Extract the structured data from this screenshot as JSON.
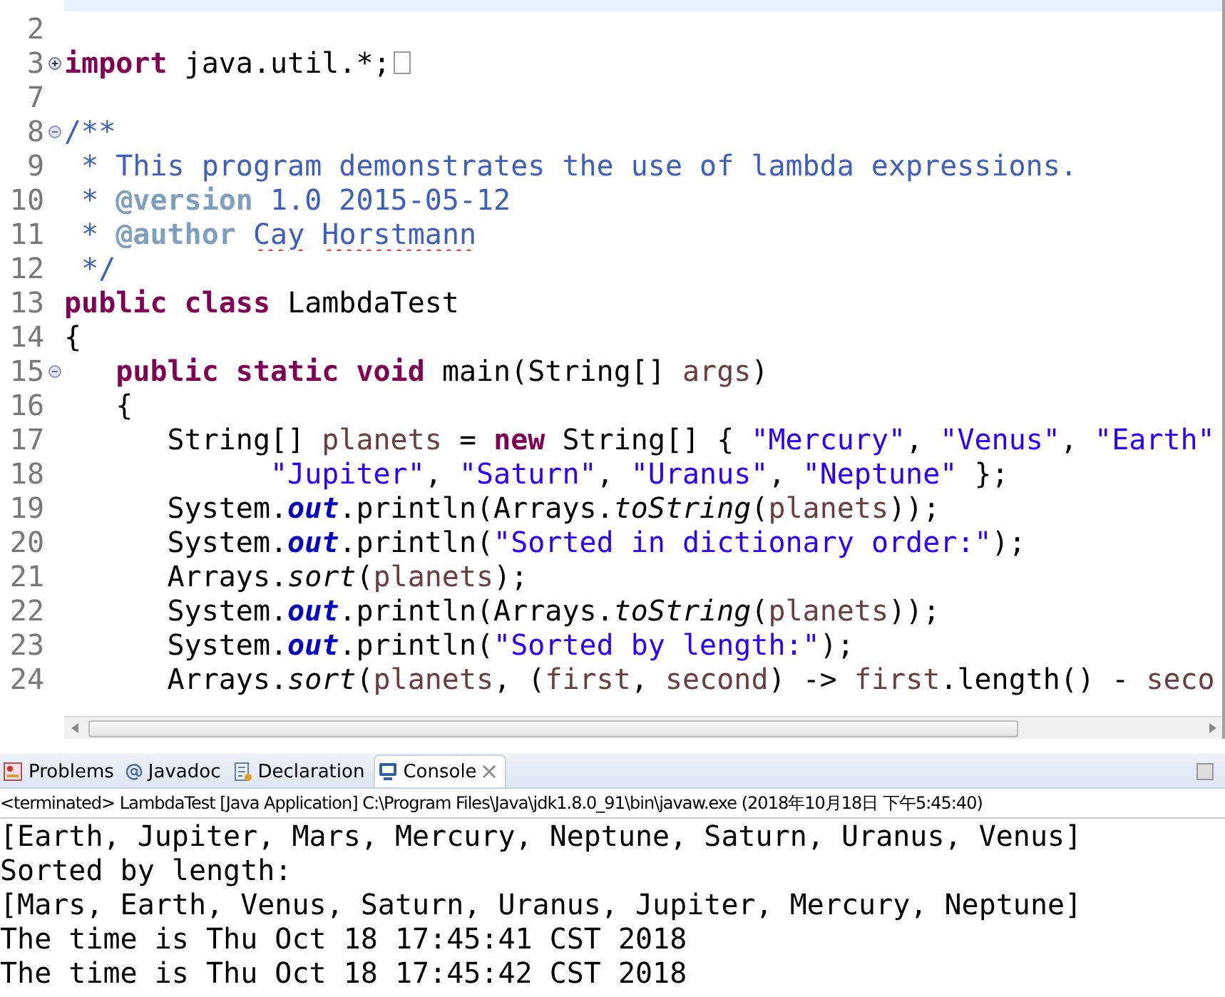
{
  "editor": {
    "lines": [
      {
        "current": true,
        "kind": "plain"
      },
      {
        "number": "2",
        "current": false,
        "kind": "plain"
      },
      {
        "number": "3",
        "current": false,
        "kind": "folded",
        "tokens": [
          {
            "text": "import",
            "kind": "keyword"
          },
          {
            "text": " java.util.*;",
            "kind": "plain"
          }
        ]
      },
      {
        "number": "7",
        "current": false,
        "kind": "plain"
      },
      {
        "number": "8",
        "current": false,
        "kind": "foldable",
        "tokens": [
          {
            "text": "/**",
            "kind": "javadoc"
          }
        ]
      },
      {
        "number": "9",
        "current": false,
        "kind": "plain",
        "tokens": [
          {
            "text": " * This program demonstrates the use of lambda expressions.",
            "kind": "javadoc"
          }
        ]
      },
      {
        "number": "10",
        "current": false,
        "kind": "plain",
        "tokens": [
          {
            "text": " * ",
            "kind": "javadoc"
          },
          {
            "text": "@version",
            "kind": "javadoc-tag"
          },
          {
            "text": " 1.0 2015-05-12",
            "kind": "javadoc"
          }
        ]
      },
      {
        "number": "11",
        "current": false,
        "kind": "plain",
        "tokens": [
          {
            "text": " * ",
            "kind": "javadoc"
          },
          {
            "text": "@author",
            "kind": "javadoc-tag"
          },
          {
            "text": " Cay",
            "kind": "misspelled"
          },
          {
            "text": " Horstmann",
            "kind": "misspelled"
          }
        ]
      },
      {
        "number": "12",
        "current": false,
        "kind": "plain",
        "tokens": [
          {
            "text": " */",
            "kind": "javadoc"
          }
        ]
      },
      {
        "number": "13",
        "current": false,
        "kind": "plain",
        "tokens": [
          {
            "text": "public",
            "kind": "keyword"
          },
          {
            "text": " class",
            "kind": "keyword"
          },
          {
            "text": " LambdaTest",
            "kind": "plain"
          }
        ]
      },
      {
        "number": "14",
        "current": false,
        "kind": "plain",
        "tokens": [
          {
            "text": "{",
            "kind": "plain"
          }
        ]
      },
      {
        "number": "15",
        "current": false,
        "kind": "foldable",
        "tokens": [
          {
            "text": "   public",
            "kind": "keyword"
          },
          {
            "text": " static",
            "kind": "keyword"
          },
          {
            "text": " void",
            "kind": "keyword"
          },
          {
            "text": " main(String[] ",
            "kind": "plain"
          },
          {
            "text": "args",
            "kind": "variable"
          },
          {
            "text": ")",
            "kind": "plain"
          }
        ]
      },
      {
        "number": "16",
        "current": false,
        "kind": "plain",
        "tokens": [
          {
            "text": "   {",
            "kind": "plain"
          }
        ]
      },
      {
        "number": "17",
        "current": false,
        "kind": "plain",
        "tokens": [
          {
            "text": "      String[] ",
            "kind": "plain"
          },
          {
            "text": "planets",
            "kind": "variable"
          },
          {
            "text": " = ",
            "kind": "plain"
          },
          {
            "text": "new",
            "kind": "keyword"
          },
          {
            "text": " String[] { ",
            "kind": "plain"
          },
          {
            "text": "\"Mercury\"",
            "kind": "string"
          },
          {
            "text": ", ",
            "kind": "plain"
          },
          {
            "text": "\"Venus\"",
            "kind": "string"
          },
          {
            "text": ", ",
            "kind": "plain"
          },
          {
            "text": "\"Earth\"",
            "kind": "string"
          }
        ]
      },
      {
        "number": "18",
        "current": false,
        "kind": "plain",
        "tokens": [
          {
            "text": "            \"Jupiter\"",
            "kind": "string"
          },
          {
            "text": ", ",
            "kind": "plain"
          },
          {
            "text": "\"Saturn\"",
            "kind": "string"
          },
          {
            "text": ", ",
            "kind": "plain"
          },
          {
            "text": "\"Uranus\"",
            "kind": "string"
          },
          {
            "text": ", ",
            "kind": "plain"
          },
          {
            "text": "\"Neptune\"",
            "kind": "string"
          },
          {
            "text": " };",
            "kind": "plain"
          }
        ]
      },
      {
        "number": "19",
        "current": false,
        "kind": "plain",
        "tokens": [
          {
            "text": "      System.",
            "kind": "plain"
          },
          {
            "text": "out",
            "kind": "static-field"
          },
          {
            "text": ".println(Arrays.",
            "kind": "plain"
          },
          {
            "text": "toString",
            "kind": "static-method"
          },
          {
            "text": "(",
            "kind": "plain"
          },
          {
            "text": "planets",
            "kind": "variable"
          },
          {
            "text": "));",
            "kind": "plain"
          }
        ]
      },
      {
        "number": "20",
        "current": false,
        "kind": "plain",
        "tokens": [
          {
            "text": "      System.",
            "kind": "plain"
          },
          {
            "text": "out",
            "kind": "static-field"
          },
          {
            "text": ".println(",
            "kind": "plain"
          },
          {
            "text": "\"Sorted in dictionary order:\"",
            "kind": "string"
          },
          {
            "text": ");",
            "kind": "plain"
          }
        ]
      },
      {
        "number": "21",
        "current": false,
        "kind": "plain",
        "tokens": [
          {
            "text": "      Arrays.",
            "kind": "plain"
          },
          {
            "text": "sort",
            "kind": "static-method"
          },
          {
            "text": "(",
            "kind": "plain"
          },
          {
            "text": "planets",
            "kind": "variable"
          },
          {
            "text": ");",
            "kind": "plain"
          }
        ]
      },
      {
        "number": "22",
        "current": false,
        "kind": "plain",
        "tokens": [
          {
            "text": "      System.",
            "kind": "plain"
          },
          {
            "text": "out",
            "kind": "static-field"
          },
          {
            "text": ".println(Arrays.",
            "kind": "plain"
          },
          {
            "text": "toString",
            "kind": "static-method"
          },
          {
            "text": "(",
            "kind": "plain"
          },
          {
            "text": "planets",
            "kind": "variable"
          },
          {
            "text": "));",
            "kind": "plain"
          }
        ]
      },
      {
        "number": "23",
        "current": false,
        "kind": "plain",
        "tokens": [
          {
            "text": "      System.",
            "kind": "plain"
          },
          {
            "text": "out",
            "kind": "static-field"
          },
          {
            "text": ".println(",
            "kind": "plain"
          },
          {
            "text": "\"Sorted by length:\"",
            "kind": "string"
          },
          {
            "text": ");",
            "kind": "plain"
          }
        ]
      },
      {
        "number": "24",
        "current": false,
        "kind": "plain",
        "tokens": [
          {
            "text": "      Arrays.",
            "kind": "plain"
          },
          {
            "text": "sort",
            "kind": "static-method"
          },
          {
            "text": "(",
            "kind": "plain"
          },
          {
            "text": "planets",
            "kind": "variable"
          },
          {
            "text": ", (",
            "kind": "plain"
          },
          {
            "text": "first",
            "kind": "variable"
          },
          {
            "text": ", ",
            "kind": "plain"
          },
          {
            "text": "second",
            "kind": "variable"
          },
          {
            "text": ") -> ",
            "kind": "plain"
          },
          {
            "text": "first",
            "kind": "variable"
          },
          {
            "text": ".length() - ",
            "kind": "plain"
          },
          {
            "text": "seco",
            "kind": "variable"
          }
        ]
      }
    ]
  },
  "views": {
    "tabs": [
      {
        "label": "Problems",
        "kind": "problems",
        "selected": false
      },
      {
        "label": "Javadoc",
        "kind": "javadoc",
        "selected": false
      },
      {
        "label": "Declaration",
        "kind": "declaration",
        "selected": false
      },
      {
        "label": "Console",
        "kind": "console",
        "selected": true
      }
    ]
  },
  "console": {
    "header": "<terminated> LambdaTest [Java Application] C:\\Program Files\\Java\\jdk1.8.0_91\\bin\\javaw.exe (2018年10月18日 下午5:45:40)",
    "output": [
      "[Earth, Jupiter, Mars, Mercury, Neptune, Saturn, Uranus, Venus]",
      "Sorted by length:",
      "[Mars, Earth, Venus, Saturn, Uranus, Jupiter, Mercury, Neptune]",
      "The time is Thu Oct 18 17:45:41 CST 2018",
      "The time is Thu Oct 18 17:45:42 CST 2018"
    ]
  }
}
